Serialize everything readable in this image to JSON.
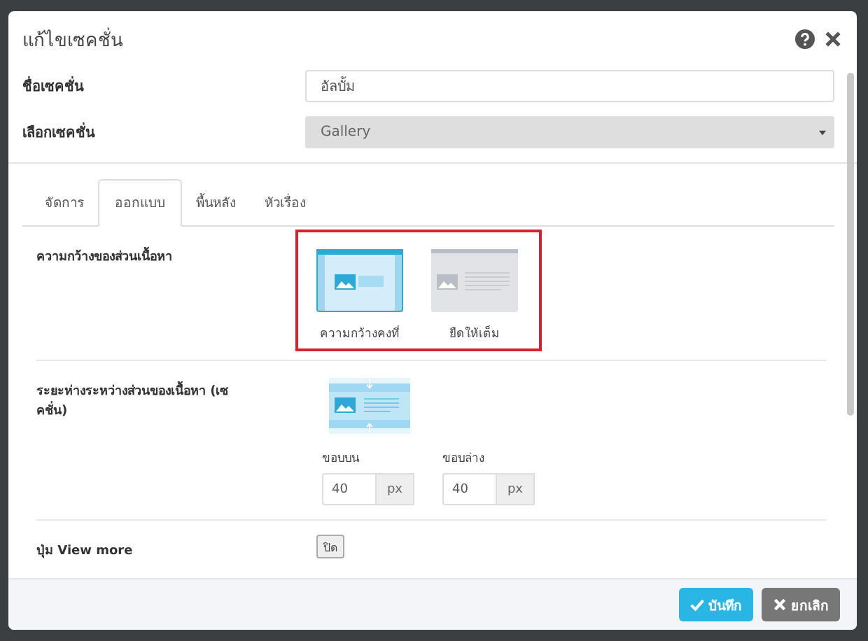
{
  "window": {
    "title": "แก้ไขเซคชั่น"
  },
  "fields": [
    {
      "label": "ชื่อเซคชั่น",
      "kind": "text",
      "value": "อัลบั้ม"
    },
    {
      "label": "เลือกเซคชั่น",
      "kind": "select",
      "value": "Gallery"
    }
  ],
  "tabs": [
    {
      "label": "จัดการ",
      "selected": false
    },
    {
      "label": "ออกแบบ",
      "selected": true
    },
    {
      "label": "พื้นหลัง",
      "selected": false
    },
    {
      "label": "หัวเรื่อง",
      "selected": false
    }
  ],
  "content_width": {
    "label": "ความกว้างของส่วนเนื้อหา",
    "options": [
      {
        "label": "ความกว้างคงที่",
        "kind": "fixed",
        "selected": true
      },
      {
        "label": "ยืดให้เต็ม",
        "kind": "full",
        "selected": false
      }
    ]
  },
  "spacing": {
    "label": "ระยะห่างระหว่างส่วนของเนื้อหา (เซคชั่น)",
    "margins": [
      {
        "label": "ขอบบน",
        "value": "40",
        "unit": "px"
      },
      {
        "label": "ขอบล่าง",
        "value": "40",
        "unit": "px"
      }
    ]
  },
  "view_more": {
    "label": "ปุ่ม View more",
    "toggle": "ปิด",
    "on": false
  },
  "buttons": [
    {
      "label": "บันทึก",
      "kind": "save"
    },
    {
      "label": "ยกเลิก",
      "kind": "cancel"
    }
  ]
}
